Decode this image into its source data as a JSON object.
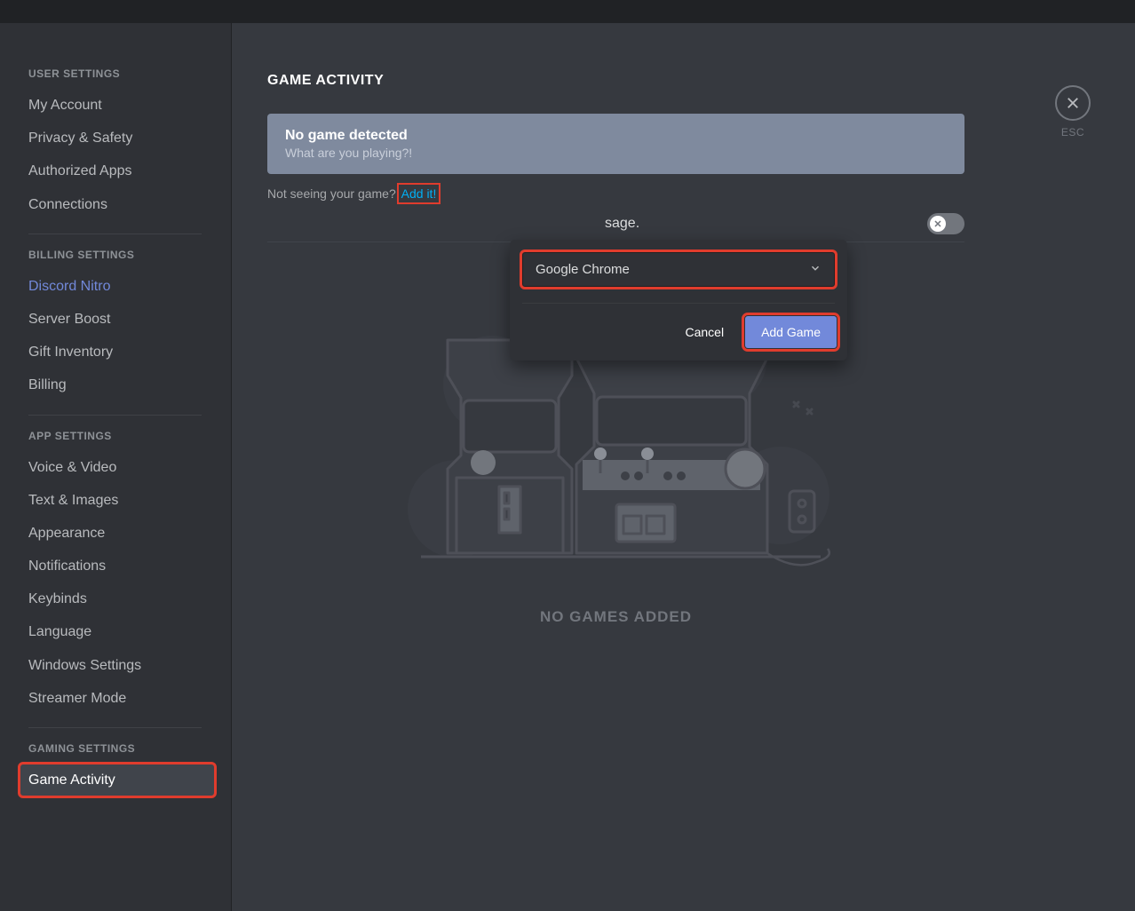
{
  "close": {
    "label": "ESC"
  },
  "sidebar": {
    "sections": [
      {
        "heading": "USER SETTINGS",
        "items": [
          {
            "label": "My Account"
          },
          {
            "label": "Privacy & Safety"
          },
          {
            "label": "Authorized Apps"
          },
          {
            "label": "Connections"
          }
        ]
      },
      {
        "heading": "BILLING SETTINGS",
        "items": [
          {
            "label": "Discord Nitro",
            "nitro": true
          },
          {
            "label": "Server Boost"
          },
          {
            "label": "Gift Inventory"
          },
          {
            "label": "Billing"
          }
        ]
      },
      {
        "heading": "APP SETTINGS",
        "items": [
          {
            "label": "Voice & Video"
          },
          {
            "label": "Text & Images"
          },
          {
            "label": "Appearance"
          },
          {
            "label": "Notifications"
          },
          {
            "label": "Keybinds"
          },
          {
            "label": "Language"
          },
          {
            "label": "Windows Settings"
          },
          {
            "label": "Streamer Mode"
          }
        ]
      },
      {
        "heading": "GAMING SETTINGS",
        "items": [
          {
            "label": "Game Activity",
            "active": true
          }
        ]
      }
    ]
  },
  "page": {
    "title": "GAME ACTIVITY",
    "banner_title": "No game detected",
    "banner_sub": "What are you playing?!",
    "hint_prefix": "Not seeing your game? ",
    "hint_link": "Add it!",
    "status_fragment": "sage.",
    "empty_label": "NO GAMES ADDED"
  },
  "popover": {
    "selected": "Google Chrome",
    "cancel_label": "Cancel",
    "add_label": "Add Game"
  },
  "toggle": {
    "on": false
  }
}
